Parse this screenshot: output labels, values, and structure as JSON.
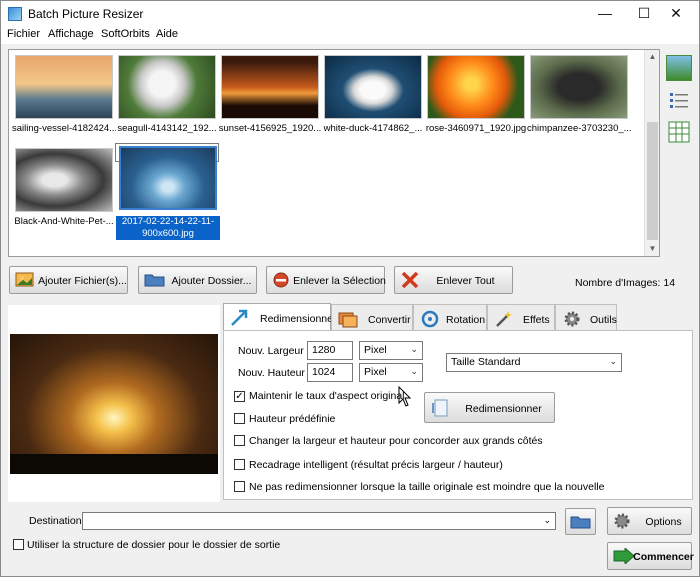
{
  "window": {
    "title": "Batch Picture Resizer",
    "minimize": "—",
    "maximize": "☐",
    "close": "✕"
  },
  "menu": [
    "Fichier",
    "Affichage",
    "SoftOrbits",
    "Aide"
  ],
  "gallery": {
    "items": [
      {
        "caption": "sailing-vessel-4182424...",
        "selected": false
      },
      {
        "caption": "seagull-4143142_192...",
        "selected": false
      },
      {
        "caption": "sunset-4156925_1920...",
        "selected": false
      },
      {
        "caption": "white-duck-4174862_...",
        "selected": false
      },
      {
        "caption": "rose-3460971_1920.jpg",
        "selected": false
      },
      {
        "caption": "chimpanzee-3703230_...",
        "selected": false
      },
      {
        "caption": "Black-And-White-Pet-...",
        "selected": false
      },
      {
        "caption": "2017-02-22-14-22-11-900x600.jpg",
        "selected": true
      }
    ]
  },
  "actions": {
    "add_files": "Ajouter Fichier(s)...",
    "add_folder": "Ajouter Dossier...",
    "remove_selection": "Enlever la Sélection",
    "remove_all": "Enlever Tout",
    "image_count": "Nombre d'Images: 14"
  },
  "tabs": [
    "Redimensionner",
    "Convertir",
    "Rotation",
    "Effets",
    "Outils"
  ],
  "resize": {
    "width_label": "Nouv. Largeur",
    "width_value": "1280",
    "width_unit": "Pixel",
    "height_label": "Nouv. Hauteur",
    "height_value": "1024",
    "height_unit": "Pixel",
    "preset": "Taille Standard",
    "resize_button": "Redimensionner",
    "options": [
      {
        "label": "Maintenir le taux d'aspect original",
        "checked": true
      },
      {
        "label": "Hauteur prédéfinie",
        "checked": false
      },
      {
        "label": "Changer la largeur et hauteur pour concorder aux grands côtés",
        "checked": false
      },
      {
        "label": "Recadrage intelligent (résultat précis largeur / hauteur)",
        "checked": false
      },
      {
        "label": "Ne pas redimensionner lorsque la taille originale est moindre que la nouvelle",
        "checked": false
      }
    ]
  },
  "destination": {
    "label": "Destination",
    "value": "",
    "use_folder_structure": "Utiliser la structure de dossier pour le dossier de sortie"
  },
  "footer": {
    "options": "Options",
    "start": "Commencer"
  }
}
